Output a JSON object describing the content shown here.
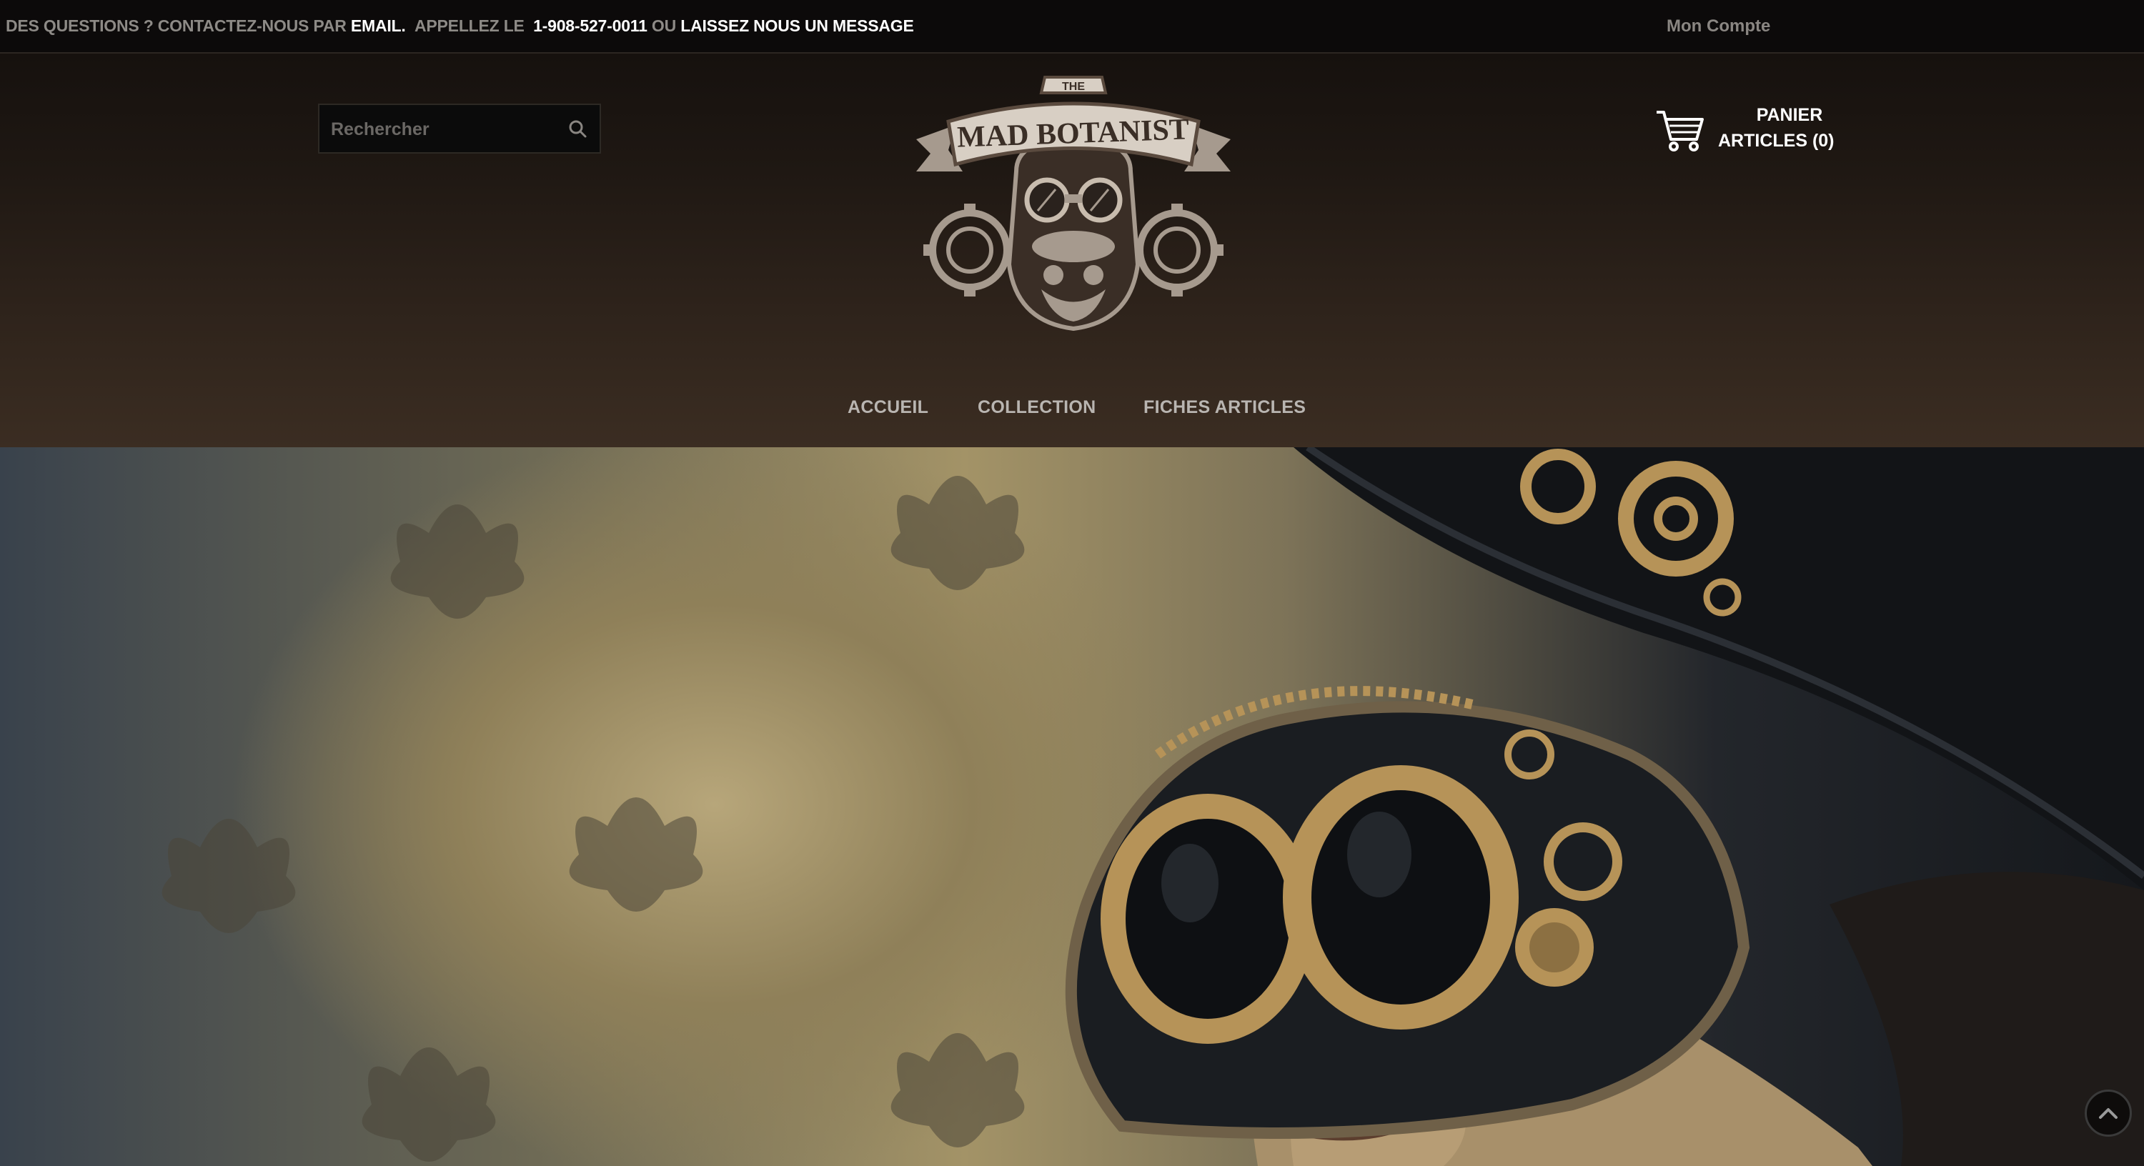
{
  "topbar": {
    "contact_prefix": "DES QUESTIONS ? CONTACTEZ-NOUS PAR",
    "email_label": "EMAIL.",
    "call_label": "APPELLEZ LE",
    "phone": "1-908-527-0011",
    "or_label": "OU",
    "message_label": "LAISSEZ NOUS UN MESSAGE",
    "account_label": "Mon Compte"
  },
  "search": {
    "placeholder": "Rechercher",
    "icon": "search-icon"
  },
  "logo": {
    "top_text": "THE",
    "banner_text": "MAD BOTANIST"
  },
  "cart": {
    "title": "PANIER",
    "items_label": "ARTICLES (0)",
    "icon": "cart-icon"
  },
  "nav": {
    "items": [
      {
        "label": "ACCUEIL"
      },
      {
        "label": "COLLECTION"
      },
      {
        "label": "FICHES ARTICLES"
      }
    ]
  },
  "hero": {
    "image": "steampunk-goggles-woman",
    "colors": {
      "sepia": "#a39367",
      "dark": "#15181c",
      "brass": "#b69358"
    }
  },
  "scroll_top": {
    "icon": "chevron-up-icon"
  }
}
